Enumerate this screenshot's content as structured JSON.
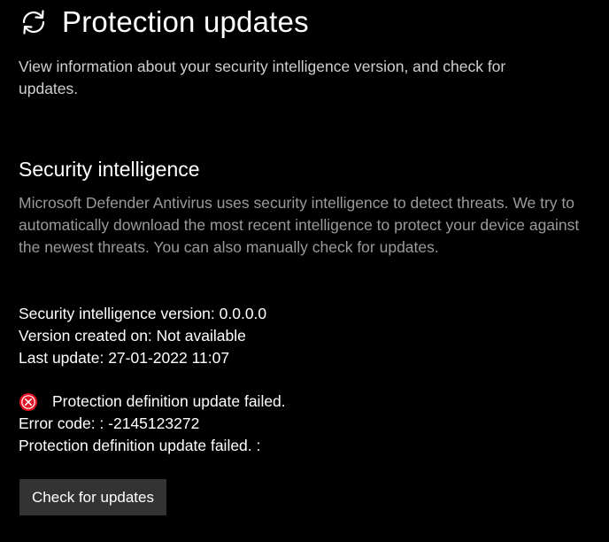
{
  "header": {
    "icon": "refresh-icon",
    "title": "Protection updates",
    "subtitle": "View information about your security intelligence version, and check for updates."
  },
  "security_intelligence": {
    "title": "Security intelligence",
    "description": "Microsoft Defender Antivirus uses security intelligence to detect threats. We try to automatically download the most recent intelligence to protect your device against the newest threats. You can also manually check for updates.",
    "version_line": "Security intelligence version: 0.0.0.0",
    "created_line": "Version created on: Not available",
    "last_update_line": "Last update: 27-01-2022 11:07"
  },
  "error": {
    "icon": "error-icon",
    "icon_color": "#e81123",
    "message": "Protection definition update failed.",
    "code_line": "Error code: : -2145123272",
    "detail_line": "Protection definition update failed. :"
  },
  "actions": {
    "check_button_label": "Check for updates"
  },
  "colors": {
    "background": "#000000",
    "text_primary": "#ffffff",
    "text_secondary": "#9a9a9a",
    "button_background": "#333333"
  }
}
